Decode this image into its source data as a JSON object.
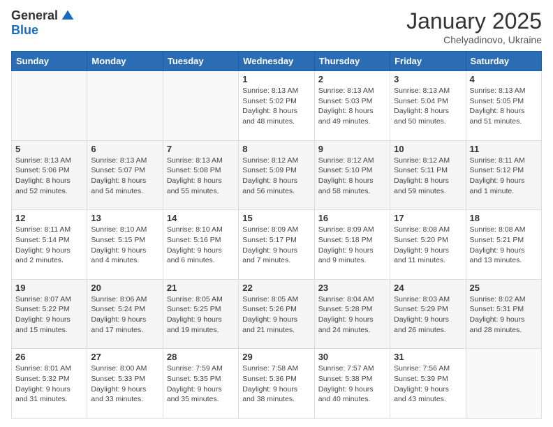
{
  "logo": {
    "general": "General",
    "blue": "Blue"
  },
  "header": {
    "month": "January 2025",
    "location": "Chelyadinovo, Ukraine"
  },
  "weekdays": [
    "Sunday",
    "Monday",
    "Tuesday",
    "Wednesday",
    "Thursday",
    "Friday",
    "Saturday"
  ],
  "weeks": [
    [
      {
        "day": "",
        "info": ""
      },
      {
        "day": "",
        "info": ""
      },
      {
        "day": "",
        "info": ""
      },
      {
        "day": "1",
        "info": "Sunrise: 8:13 AM\nSunset: 5:02 PM\nDaylight: 8 hours\nand 48 minutes."
      },
      {
        "day": "2",
        "info": "Sunrise: 8:13 AM\nSunset: 5:03 PM\nDaylight: 8 hours\nand 49 minutes."
      },
      {
        "day": "3",
        "info": "Sunrise: 8:13 AM\nSunset: 5:04 PM\nDaylight: 8 hours\nand 50 minutes."
      },
      {
        "day": "4",
        "info": "Sunrise: 8:13 AM\nSunset: 5:05 PM\nDaylight: 8 hours\nand 51 minutes."
      }
    ],
    [
      {
        "day": "5",
        "info": "Sunrise: 8:13 AM\nSunset: 5:06 PM\nDaylight: 8 hours\nand 52 minutes."
      },
      {
        "day": "6",
        "info": "Sunrise: 8:13 AM\nSunset: 5:07 PM\nDaylight: 8 hours\nand 54 minutes."
      },
      {
        "day": "7",
        "info": "Sunrise: 8:13 AM\nSunset: 5:08 PM\nDaylight: 8 hours\nand 55 minutes."
      },
      {
        "day": "8",
        "info": "Sunrise: 8:12 AM\nSunset: 5:09 PM\nDaylight: 8 hours\nand 56 minutes."
      },
      {
        "day": "9",
        "info": "Sunrise: 8:12 AM\nSunset: 5:10 PM\nDaylight: 8 hours\nand 58 minutes."
      },
      {
        "day": "10",
        "info": "Sunrise: 8:12 AM\nSunset: 5:11 PM\nDaylight: 8 hours\nand 59 minutes."
      },
      {
        "day": "11",
        "info": "Sunrise: 8:11 AM\nSunset: 5:12 PM\nDaylight: 9 hours\nand 1 minute."
      }
    ],
    [
      {
        "day": "12",
        "info": "Sunrise: 8:11 AM\nSunset: 5:14 PM\nDaylight: 9 hours\nand 2 minutes."
      },
      {
        "day": "13",
        "info": "Sunrise: 8:10 AM\nSunset: 5:15 PM\nDaylight: 9 hours\nand 4 minutes."
      },
      {
        "day": "14",
        "info": "Sunrise: 8:10 AM\nSunset: 5:16 PM\nDaylight: 9 hours\nand 6 minutes."
      },
      {
        "day": "15",
        "info": "Sunrise: 8:09 AM\nSunset: 5:17 PM\nDaylight: 9 hours\nand 7 minutes."
      },
      {
        "day": "16",
        "info": "Sunrise: 8:09 AM\nSunset: 5:18 PM\nDaylight: 9 hours\nand 9 minutes."
      },
      {
        "day": "17",
        "info": "Sunrise: 8:08 AM\nSunset: 5:20 PM\nDaylight: 9 hours\nand 11 minutes."
      },
      {
        "day": "18",
        "info": "Sunrise: 8:08 AM\nSunset: 5:21 PM\nDaylight: 9 hours\nand 13 minutes."
      }
    ],
    [
      {
        "day": "19",
        "info": "Sunrise: 8:07 AM\nSunset: 5:22 PM\nDaylight: 9 hours\nand 15 minutes."
      },
      {
        "day": "20",
        "info": "Sunrise: 8:06 AM\nSunset: 5:24 PM\nDaylight: 9 hours\nand 17 minutes."
      },
      {
        "day": "21",
        "info": "Sunrise: 8:05 AM\nSunset: 5:25 PM\nDaylight: 9 hours\nand 19 minutes."
      },
      {
        "day": "22",
        "info": "Sunrise: 8:05 AM\nSunset: 5:26 PM\nDaylight: 9 hours\nand 21 minutes."
      },
      {
        "day": "23",
        "info": "Sunrise: 8:04 AM\nSunset: 5:28 PM\nDaylight: 9 hours\nand 24 minutes."
      },
      {
        "day": "24",
        "info": "Sunrise: 8:03 AM\nSunset: 5:29 PM\nDaylight: 9 hours\nand 26 minutes."
      },
      {
        "day": "25",
        "info": "Sunrise: 8:02 AM\nSunset: 5:31 PM\nDaylight: 9 hours\nand 28 minutes."
      }
    ],
    [
      {
        "day": "26",
        "info": "Sunrise: 8:01 AM\nSunset: 5:32 PM\nDaylight: 9 hours\nand 31 minutes."
      },
      {
        "day": "27",
        "info": "Sunrise: 8:00 AM\nSunset: 5:33 PM\nDaylight: 9 hours\nand 33 minutes."
      },
      {
        "day": "28",
        "info": "Sunrise: 7:59 AM\nSunset: 5:35 PM\nDaylight: 9 hours\nand 35 minutes."
      },
      {
        "day": "29",
        "info": "Sunrise: 7:58 AM\nSunset: 5:36 PM\nDaylight: 9 hours\nand 38 minutes."
      },
      {
        "day": "30",
        "info": "Sunrise: 7:57 AM\nSunset: 5:38 PM\nDaylight: 9 hours\nand 40 minutes."
      },
      {
        "day": "31",
        "info": "Sunrise: 7:56 AM\nSunset: 5:39 PM\nDaylight: 9 hours\nand 43 minutes."
      },
      {
        "day": "",
        "info": ""
      }
    ]
  ]
}
